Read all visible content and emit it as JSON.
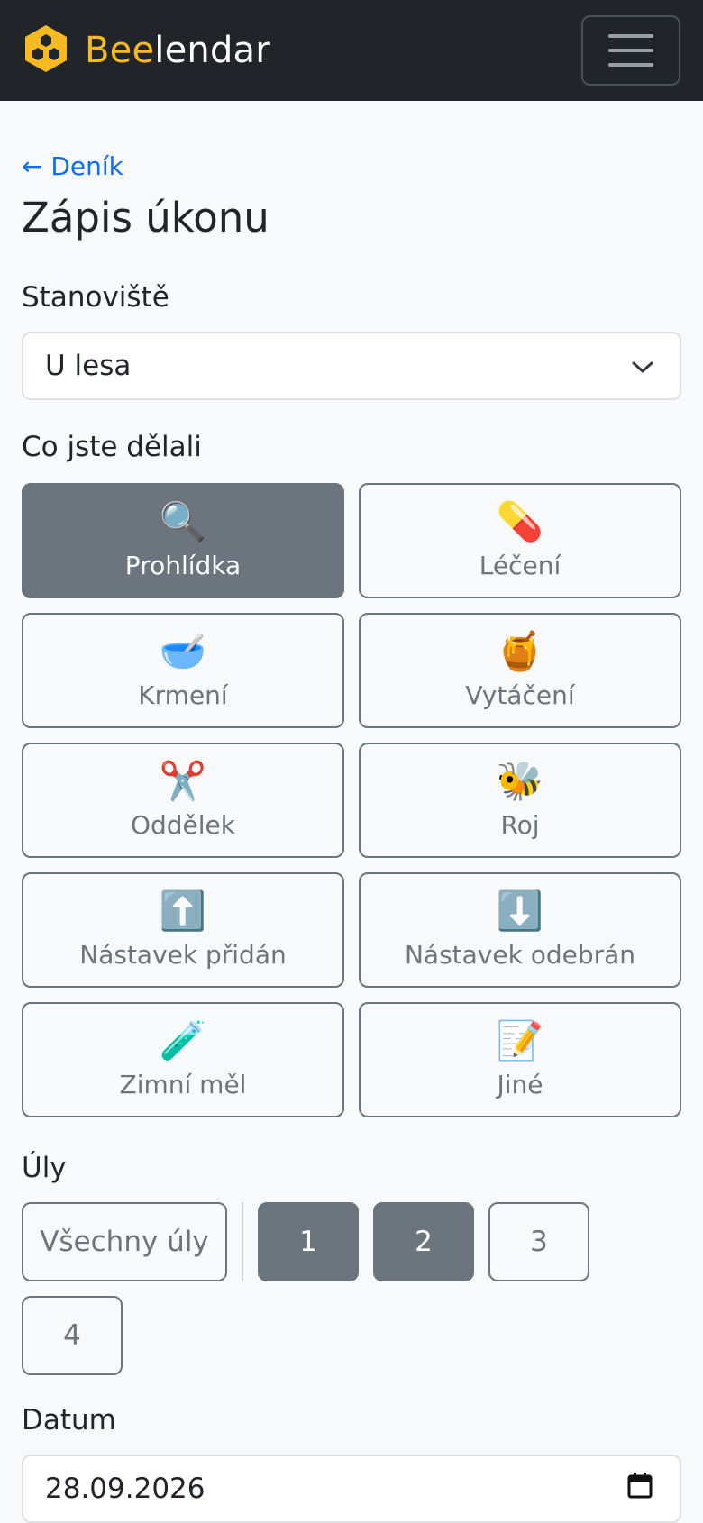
{
  "nav": {
    "brand_accent": "Bee",
    "brand_rest": "lendar",
    "menu_icon": "hamburger-icon",
    "accent_color": "#f5b921"
  },
  "back_link": "← Deník",
  "title": "Zápis úkonu",
  "station": {
    "label": "Stanoviště",
    "value": "U lesa"
  },
  "activities": {
    "label": "Co jste dělali",
    "items": [
      {
        "icon": "🔍",
        "label": "Prohlídka",
        "active": true
      },
      {
        "icon": "💊",
        "label": "Léčení"
      },
      {
        "icon": "🥣",
        "label": "Krmení"
      },
      {
        "icon": "🍯",
        "label": "Vytáčení"
      },
      {
        "icon": "✂️",
        "label": "Oddělek"
      },
      {
        "icon": "🐝",
        "label": "Roj"
      },
      {
        "icon": "⬆️",
        "label": "Nástavek přidán"
      },
      {
        "icon": "⬇️",
        "label": "Nástavek odebrán"
      },
      {
        "icon": "🧪",
        "label": "Zimní měl"
      },
      {
        "icon": "📝",
        "label": "Jiné"
      }
    ]
  },
  "hives": {
    "label": "Úly",
    "all_label": "Všechny úly",
    "items": [
      "1",
      "2",
      "3",
      "4"
    ],
    "selected": [
      "1",
      "2"
    ]
  },
  "date": {
    "label": "Datum",
    "value": "28.09.2026"
  }
}
